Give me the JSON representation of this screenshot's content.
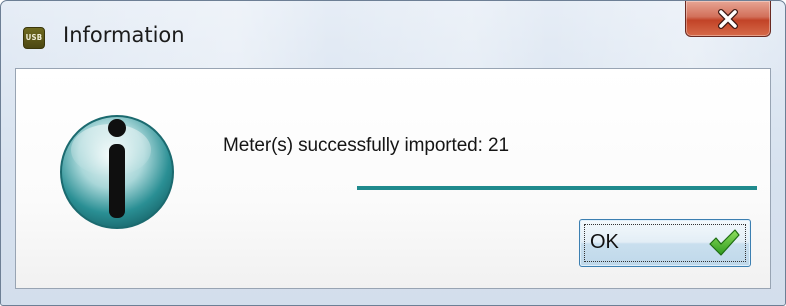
{
  "window": {
    "title": "Information",
    "app_icon_text": "USB",
    "close_symbol": "X"
  },
  "message": {
    "text": "Meter(s) successfully imported: 21",
    "icon": "information-icon"
  },
  "progress": {
    "fraction": 1.0,
    "color": "#1f8a8d"
  },
  "buttons": {
    "ok_label": "OK",
    "ok_icon": "checkmark-icon"
  },
  "colors": {
    "info_icon": "#2a8f94",
    "close_button": "#c24327",
    "check": "#3fae2a"
  }
}
